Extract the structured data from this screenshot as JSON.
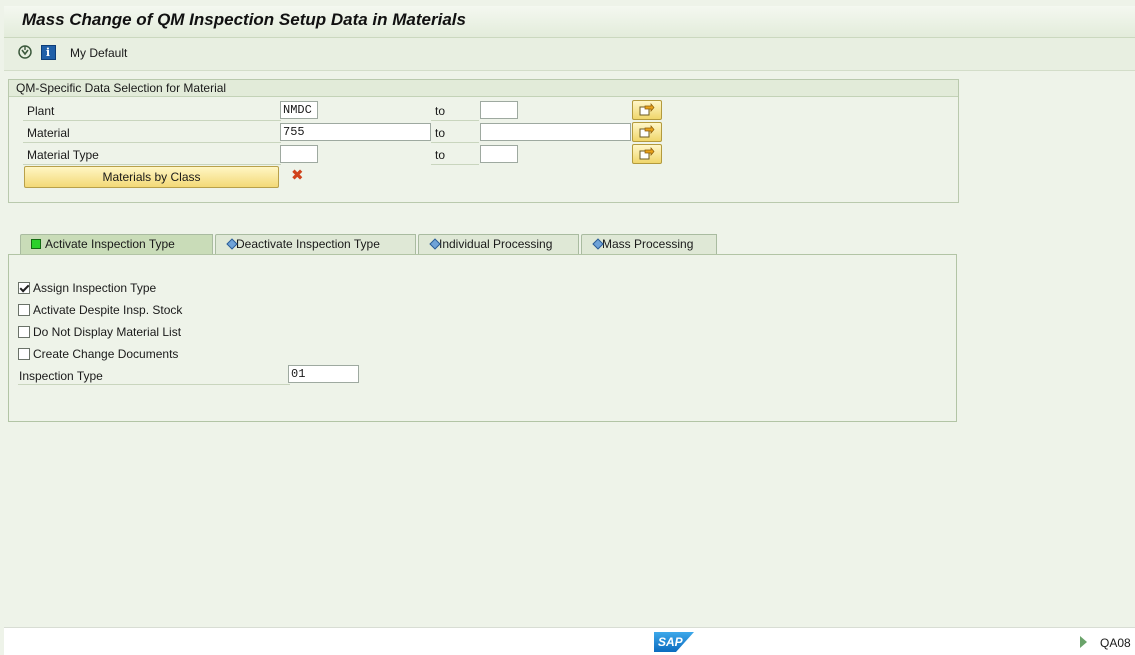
{
  "window": {
    "title": "Mass Change of QM Inspection Setup Data in Materials"
  },
  "toolbar": {
    "icons": [
      "execute-icon",
      "info-icon"
    ],
    "info_glyph": "i",
    "variant_label": "My Default"
  },
  "selection": {
    "group_title": "QM-Specific Data Selection for Material",
    "rows": [
      {
        "label": "Plant",
        "from": "NMDC",
        "to_label": "to",
        "to": ""
      },
      {
        "label": "Material",
        "from": "755",
        "to_label": "to",
        "to": ""
      },
      {
        "label": "Material Type",
        "from": "",
        "to_label": "to",
        "to": ""
      }
    ],
    "class_button": "Materials by Class"
  },
  "tabs": [
    {
      "label": "Activate Inspection Type",
      "active": true,
      "icon": "green-square-icon"
    },
    {
      "label": "Deactivate Inspection Type",
      "active": false,
      "icon": "diamond-icon"
    },
    {
      "label": "Individual Processing",
      "active": false,
      "icon": "diamond-icon"
    },
    {
      "label": "Mass Processing",
      "active": false,
      "icon": "diamond-icon"
    }
  ],
  "options": {
    "checkboxes": [
      {
        "label": "Assign Inspection Type",
        "checked": true
      },
      {
        "label": "Activate Despite Insp. Stock",
        "checked": false
      },
      {
        "label": "Do Not Display Material List",
        "checked": false
      },
      {
        "label": "Create Change Documents",
        "checked": false
      }
    ],
    "inspection_type_label": "Inspection Type",
    "inspection_type_value": "01"
  },
  "footer": {
    "logo": "SAP",
    "tcode": "QA08"
  },
  "colors": {
    "background": "#eef3e9",
    "button_yellow": "#f3d977",
    "active_tab_icon": "#2bd02b"
  }
}
